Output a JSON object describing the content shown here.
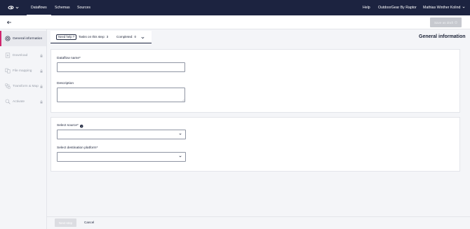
{
  "topnav": {
    "items": [
      {
        "label": "Dataflows",
        "active": true
      },
      {
        "label": "Schemas"
      },
      {
        "label": "Sources"
      }
    ],
    "help": "Help",
    "org": "OutdoorGear By Raptor",
    "user": "Mathias Winther Kolind"
  },
  "toolbar": {
    "save_draft": "Save as draft"
  },
  "sidebar": {
    "items": [
      {
        "label": "General information",
        "icon": "gear-icon",
        "active": true
      },
      {
        "label": "Download",
        "icon": "download-icon",
        "locked": true
      },
      {
        "label": "File mapping",
        "icon": "file-mapping-icon",
        "locked": true
      },
      {
        "label": "Transform & Map",
        "icon": "transform-icon",
        "locked": true
      },
      {
        "label": "Activate",
        "icon": "activate-icon",
        "locked": true
      }
    ]
  },
  "steps": {
    "help": "Need help ?",
    "tasks_label": "Tasks on this step:",
    "tasks_value": "3",
    "completed_label": "Completed:",
    "completed_value": "0"
  },
  "section": {
    "title": "General information"
  },
  "form": {
    "dataflow_name_label": "Dataflow name*",
    "dataflow_name_value": "",
    "description_label": "Description",
    "description_value": "",
    "source_label": "Select source*",
    "source_value": "",
    "destination_label": "Select destination platform*",
    "destination_value": ""
  },
  "footer": {
    "next": "Next step",
    "cancel": "Cancel"
  },
  "colors": {
    "nav_bg": "#1c2340",
    "accent": "#d0246d",
    "page_bg": "#f4f5f8"
  }
}
